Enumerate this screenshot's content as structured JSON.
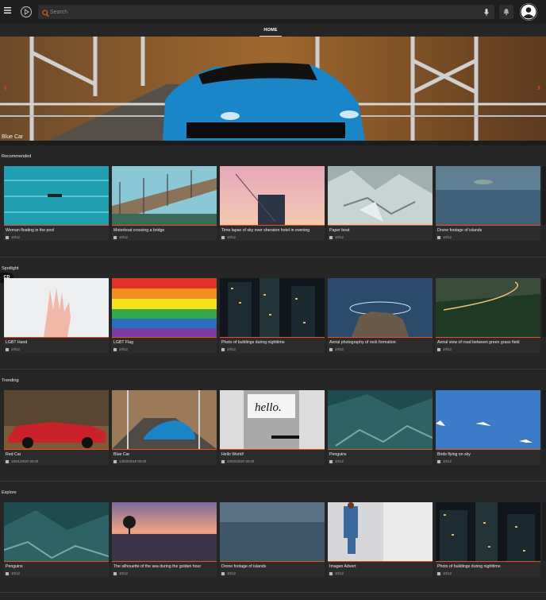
{
  "search": {
    "placeholder": "Search"
  },
  "nav": {
    "tabs": [
      {
        "label": "HOME"
      }
    ]
  },
  "hero": {
    "caption": "Blue Car",
    "prev_icon": "chevron-left-icon",
    "next_icon": "chevron-right-icon"
  },
  "badge": {
    "label": "CD"
  },
  "sections": [
    {
      "title": "Recommended",
      "cards": [
        {
          "title": "Woman floating in the pool",
          "date": "10/12"
        },
        {
          "title": "Motorboat crossing a bridge",
          "date": "10/12"
        },
        {
          "title": "Time lapse of sky over sheraton hotel in evening",
          "date": "10/12"
        },
        {
          "title": "Paper boat",
          "date": "10/12"
        },
        {
          "title": "Drone footage of islands",
          "date": "10/12"
        }
      ]
    },
    {
      "title": "Spotlight",
      "cards": [
        {
          "title": "LGBT Hand",
          "date": "10/12"
        },
        {
          "title": "LGBT Flag",
          "date": "10/12"
        },
        {
          "title": "Photo of buildings during nighttime",
          "date": "10/12"
        },
        {
          "title": "Aerial photography of rock formation",
          "date": "10/12"
        },
        {
          "title": "Aerial view of road between green grass field",
          "date": "10/12"
        }
      ]
    },
    {
      "title": "Trending",
      "cards": [
        {
          "title": "Red Car",
          "date": "16/01/2020 00:00"
        },
        {
          "title": "Blue Car",
          "date": "13/03/2019 00:00"
        },
        {
          "title": "Hello World!",
          "date": "20/02/2020 00:00"
        },
        {
          "title": "Penguins",
          "date": "10/12"
        },
        {
          "title": "Birds flying on sky",
          "date": "10/12"
        }
      ]
    },
    {
      "title": "Explore",
      "cards": [
        {
          "title": "Penguins",
          "date": "10/12"
        },
        {
          "title": "The silhouette of the sea during the golden hour",
          "date": "10/12"
        },
        {
          "title": "Drone footage of islands",
          "date": "10/12"
        },
        {
          "title": "Imagen Advert",
          "date": "10/12"
        },
        {
          "title": "Photo of buildings during nighttime",
          "date": "10/12"
        }
      ]
    }
  ],
  "colors": {
    "accent": "#e8511c",
    "background": "#262626",
    "topbar": "#1f1f1f"
  }
}
